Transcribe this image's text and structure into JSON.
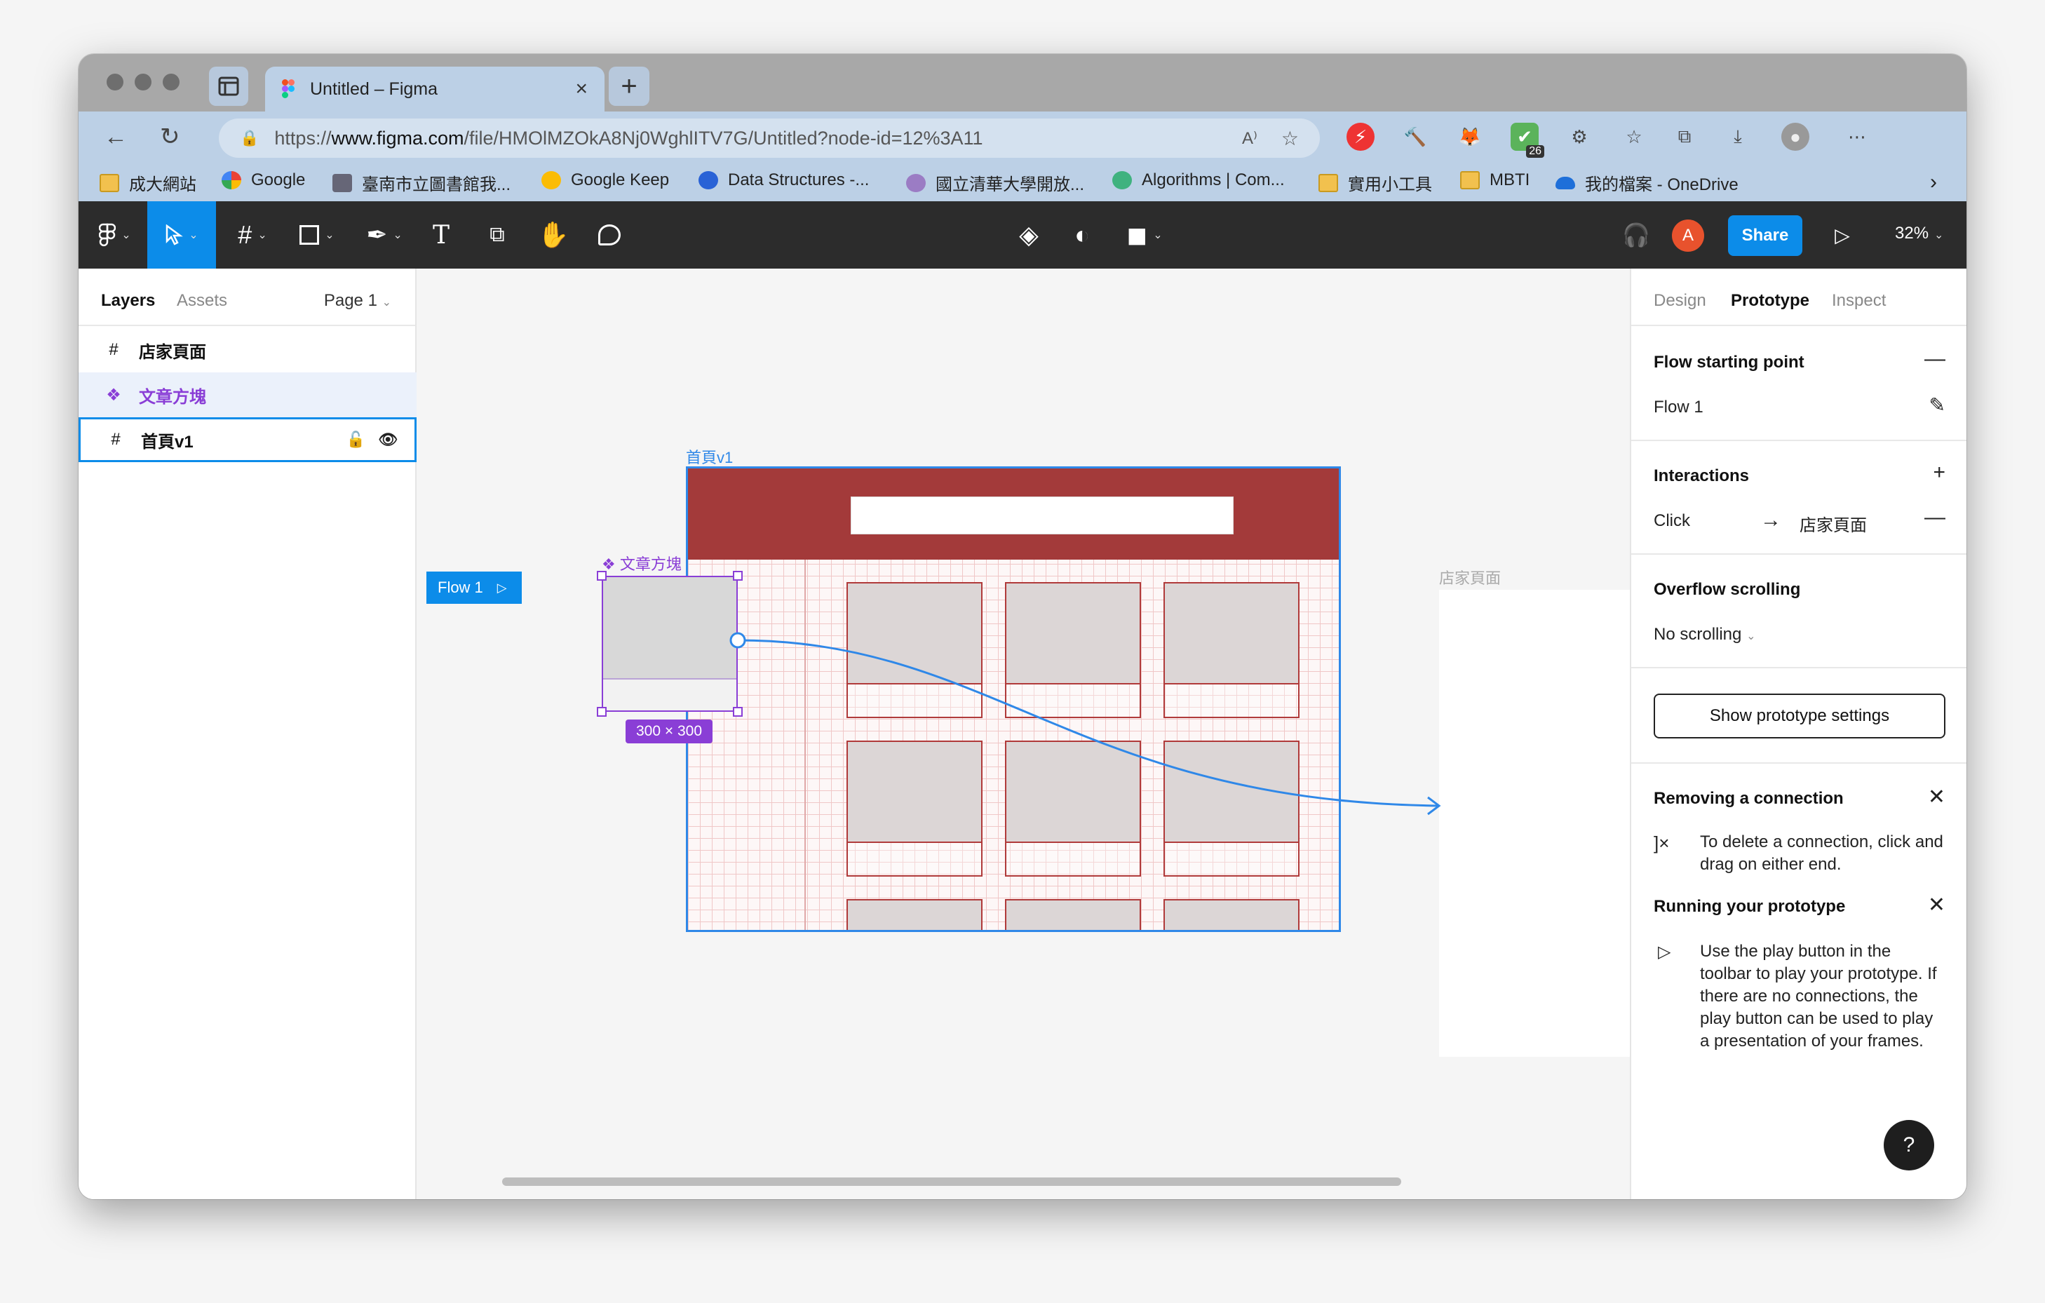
{
  "browser": {
    "tab_title": "Untitled – Figma",
    "url_prefix": "https://",
    "url_domain": "www.figma.com",
    "url_path": "/file/HMOlMZOkA8Nj0WghlITV7G/Untitled?node-id=12%3A11",
    "extension_badge": "26",
    "bookmarks": [
      {
        "label": "成大網站",
        "icon": "folder-icon"
      },
      {
        "label": "Google",
        "icon": "google-icon"
      },
      {
        "label": "臺南市立圖書館我...",
        "icon": "library-icon"
      },
      {
        "label": "Google Keep",
        "icon": "keep-icon"
      },
      {
        "label": "Data Structures -...",
        "icon": "c-icon"
      },
      {
        "label": "國立清華大學開放...",
        "icon": "nthu-icon"
      },
      {
        "label": "Algorithms | Com...",
        "icon": "check-shield-icon"
      },
      {
        "label": "實用小工具",
        "icon": "folder-icon"
      },
      {
        "label": "MBTI",
        "icon": "folder-icon"
      },
      {
        "label": "我的檔案 - OneDrive",
        "icon": "onedrive-icon"
      }
    ]
  },
  "toolbar": {
    "share_label": "Share",
    "avatar_letter": "A",
    "zoom": "32%"
  },
  "left_panel": {
    "tabs": [
      "Layers",
      "Assets"
    ],
    "page": "Page 1",
    "layers": [
      {
        "name": "店家頁面",
        "type": "frame"
      },
      {
        "name": "文章方塊",
        "type": "component"
      },
      {
        "name": "首頁v1",
        "type": "frame"
      }
    ]
  },
  "canvas": {
    "main_frame_label": "首頁v1",
    "component_label": "文章方塊",
    "store_frame_label": "店家頁面",
    "flow_tag": "Flow 1",
    "dimensions": "300 × 300"
  },
  "right_panel": {
    "tabs": [
      "Design",
      "Prototype",
      "Inspect"
    ],
    "flow_starting_point": {
      "title": "Flow starting point",
      "flow_name": "Flow 1"
    },
    "interactions": {
      "title": "Interactions",
      "trigger": "Click",
      "destination": "店家頁面"
    },
    "overflow": {
      "title": "Overflow scrolling",
      "value": "No scrolling"
    },
    "settings_button": "Show prototype settings",
    "removing": {
      "title": "Removing a connection",
      "text": "To delete a connection, click and drag on either end."
    },
    "running": {
      "title": "Running your prototype",
      "text": "Use the play button in the toolbar to play your prototype. If there are no connections, the play button can be used to play a presentation of your frames."
    },
    "help": "?"
  },
  "colors": {
    "accent": "#0c8ce9",
    "component": "#8a3ed6",
    "frame_header": "#a33a3a"
  }
}
